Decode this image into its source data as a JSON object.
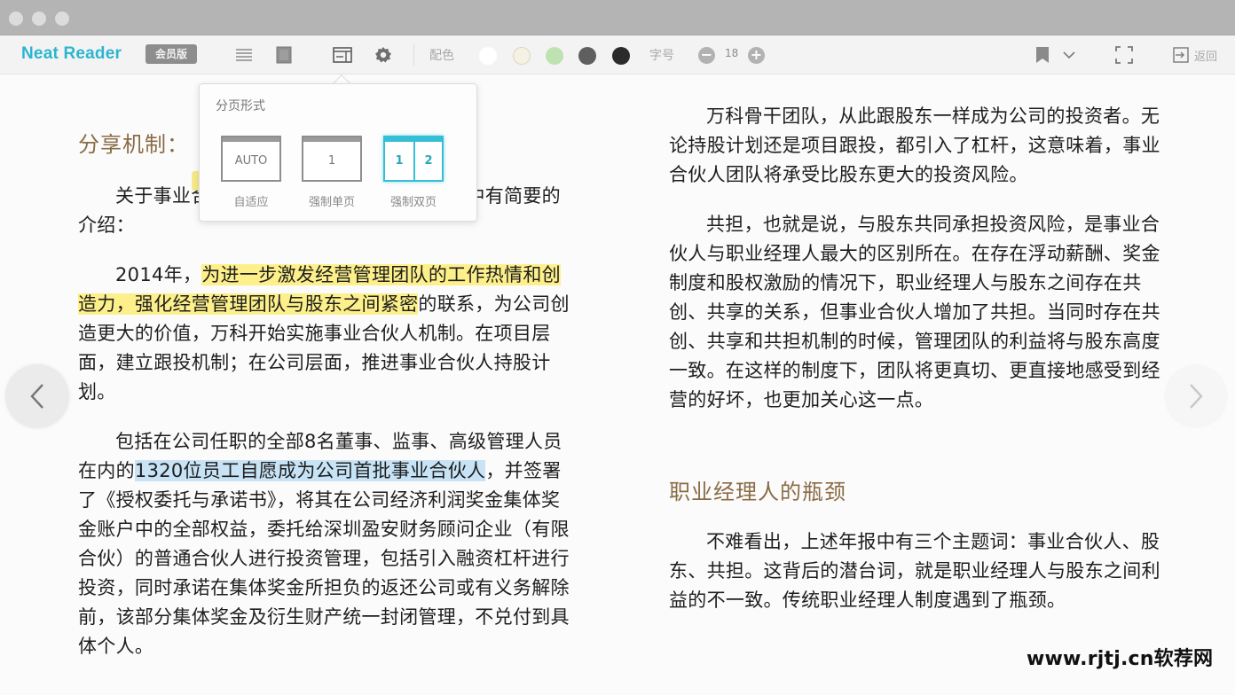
{
  "app": {
    "name": "Neat Reader",
    "edition_badge": "会员版"
  },
  "toolbar": {
    "icons": [
      "list-icon",
      "book-icon",
      "layout-icon",
      "gear-icon"
    ],
    "color_scheme_label": "配色",
    "color_swatches": [
      {
        "name": "white",
        "hex": "#ffffff"
      },
      {
        "name": "cream",
        "hex": "#f5f1e4"
      },
      {
        "name": "green",
        "hex": "#bfe3b0"
      },
      {
        "name": "gray",
        "hex": "#5f5f5f"
      },
      {
        "name": "black",
        "hex": "#2b2b2b"
      }
    ],
    "font_size_label": "字号",
    "font_size_value": "18",
    "decrease_symbol": "−",
    "increase_symbol": "+",
    "back_label": "返回"
  },
  "page_mode_popover": {
    "title": "分页形式",
    "options": [
      {
        "preview": "AUTO",
        "caption": "自适应",
        "selected": false
      },
      {
        "preview": "1",
        "caption": "强制单页",
        "selected": false
      },
      {
        "preview_left": "1",
        "preview_right": "2",
        "caption": "强制双页",
        "selected": true
      }
    ]
  },
  "left_page": {
    "heading": "分享机制：",
    "para1": "关于事业合伙人机制，万科在2014年年报中有简要的介绍：",
    "para2_prefix": "2014年，",
    "para2_highlight": "为进一步激发经营管理团队的工作热情和创造力，强化经营管理团队与股东之间紧密",
    "para2_suffix": "的联系，为公司创造更大的价值，万科开始实施事业合伙人机制。在项目层面，建立跟投机制；在公司层面，推进事业合伙人持股计划。",
    "para3_prefix": "包括在公司任职的全部8名董事、监事、高级管理人员在内的",
    "para3_highlight": "1320位员工自愿成为公司首批事业合伙人",
    "para3_suffix": "，并签署了《授权委托与承诺书》，将其在公司经济利润奖金集体奖金账户中的全部权益，委托给深圳盈安财务顾问企业（有限合伙）的普通合伙人进行投资管理，包括引入融资杠杆进行投资，同时承诺在集体奖金所担负的返还公司或有义务解除前，该部分集体奖金及衍生财产统一封闭管理，不兑付到具体个人。",
    "highlight_colors": {
      "yellow": "#fdf08a",
      "blue": "#c7e3f5"
    }
  },
  "right_page": {
    "para1": "万科骨干团队，从此跟股东一样成为公司的投资者。无论持股计划还是项目跟投，都引入了杠杆，这意味着，事业合伙人团队将承受比股东更大的投资风险。",
    "para2": "共担，也就是说，与股东共同承担投资风险，是事业合伙人与职业经理人最大的区别所在。在存在浮动薪酬、奖金制度和股权激励的情况下，职业经理人与股东之间存在共创、共享的关系，但事业合伙人增加了共担。当同时存在共创、共享和共担机制的时候，管理团队的利益将与股东高度一致。在这样的制度下，团队将更真切、更直接地感受到经营的好坏，也更加关心这一点。",
    "heading": "职业经理人的瓶颈",
    "para3": "不难看出，上述年报中有三个主题词：事业合伙人、股东、共担。这背后的潜台词，就是职业经理人与股东之间利益的不一致。传统职业经理人制度遇到了瓶颈。"
  },
  "watermark": "www.rjtj.cn软荐网"
}
